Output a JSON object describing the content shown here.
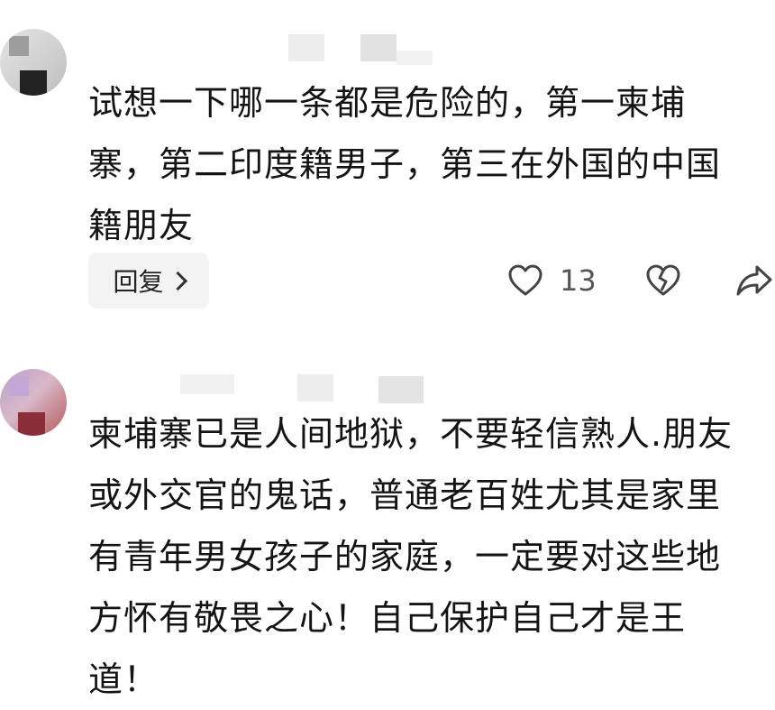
{
  "comments": [
    {
      "body": "试想一下哪一条都是危险的，第一柬埔寨，第二印度籍男子，第三在外国的中国籍朋友",
      "reply_label": "回复",
      "like_count": "13"
    },
    {
      "body": "柬埔寨已是人间地狱，不要轻信熟人.朋友或外交官的鬼话，普通老百姓尤其是家里有青年男女孩子的家庭，一定要对这些地方怀有敬畏之心！自己保护自己才是王道！"
    }
  ],
  "icons": {
    "like": "heart-outline-icon",
    "dislike": "broken-heart-icon",
    "share": "share-arrow-icon",
    "reply_chevron": "chevron-right-icon"
  },
  "colors": {
    "text": "#141414",
    "muted": "#555555",
    "reply_bg": "#f3f3f3"
  }
}
